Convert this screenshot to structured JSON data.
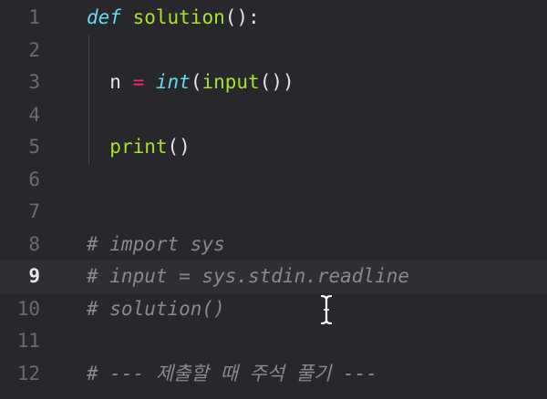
{
  "editor": {
    "current_line": 9,
    "lines": [
      {
        "number": "1",
        "tokens": [
          {
            "t": "def",
            "c": "kw"
          },
          {
            "t": " ",
            "c": "plain"
          },
          {
            "t": "solution",
            "c": "fn"
          },
          {
            "t": "():",
            "c": "plain"
          }
        ]
      },
      {
        "number": "2",
        "tokens": []
      },
      {
        "number": "3",
        "tokens": [
          {
            "t": "  n ",
            "c": "plain"
          },
          {
            "t": "=",
            "c": "op"
          },
          {
            "t": " ",
            "c": "plain"
          },
          {
            "t": "int",
            "c": "builtin"
          },
          {
            "t": "(",
            "c": "plain"
          },
          {
            "t": "input",
            "c": "fn"
          },
          {
            "t": "())",
            "c": "plain"
          }
        ]
      },
      {
        "number": "4",
        "tokens": []
      },
      {
        "number": "5",
        "tokens": [
          {
            "t": "  ",
            "c": "plain"
          },
          {
            "t": "print",
            "c": "fn"
          },
          {
            "t": "()",
            "c": "plain"
          }
        ]
      },
      {
        "number": "6",
        "tokens": []
      },
      {
        "number": "7",
        "tokens": []
      },
      {
        "number": "8",
        "tokens": [
          {
            "t": "# import sys",
            "c": "comment"
          }
        ]
      },
      {
        "number": "9",
        "tokens": [
          {
            "t": "# input = sys.stdin.readline",
            "c": "comment"
          }
        ]
      },
      {
        "number": "10",
        "tokens": [
          {
            "t": "# solution()",
            "c": "comment"
          }
        ]
      },
      {
        "number": "11",
        "tokens": []
      },
      {
        "number": "12",
        "tokens": [
          {
            "t": "# --- 제출할 때 주석 풀기 ---",
            "c": "comment"
          }
        ]
      }
    ]
  },
  "colors": {
    "background": "#28272c",
    "current_line_background": "#2f2e34",
    "keyword": "#66d9ef",
    "function": "#a6e22e",
    "operator": "#f92672",
    "comment": "#8a8990",
    "line_number": "#6b6a70"
  },
  "icons": {
    "cursor": "text-cursor-ibeam-icon"
  }
}
